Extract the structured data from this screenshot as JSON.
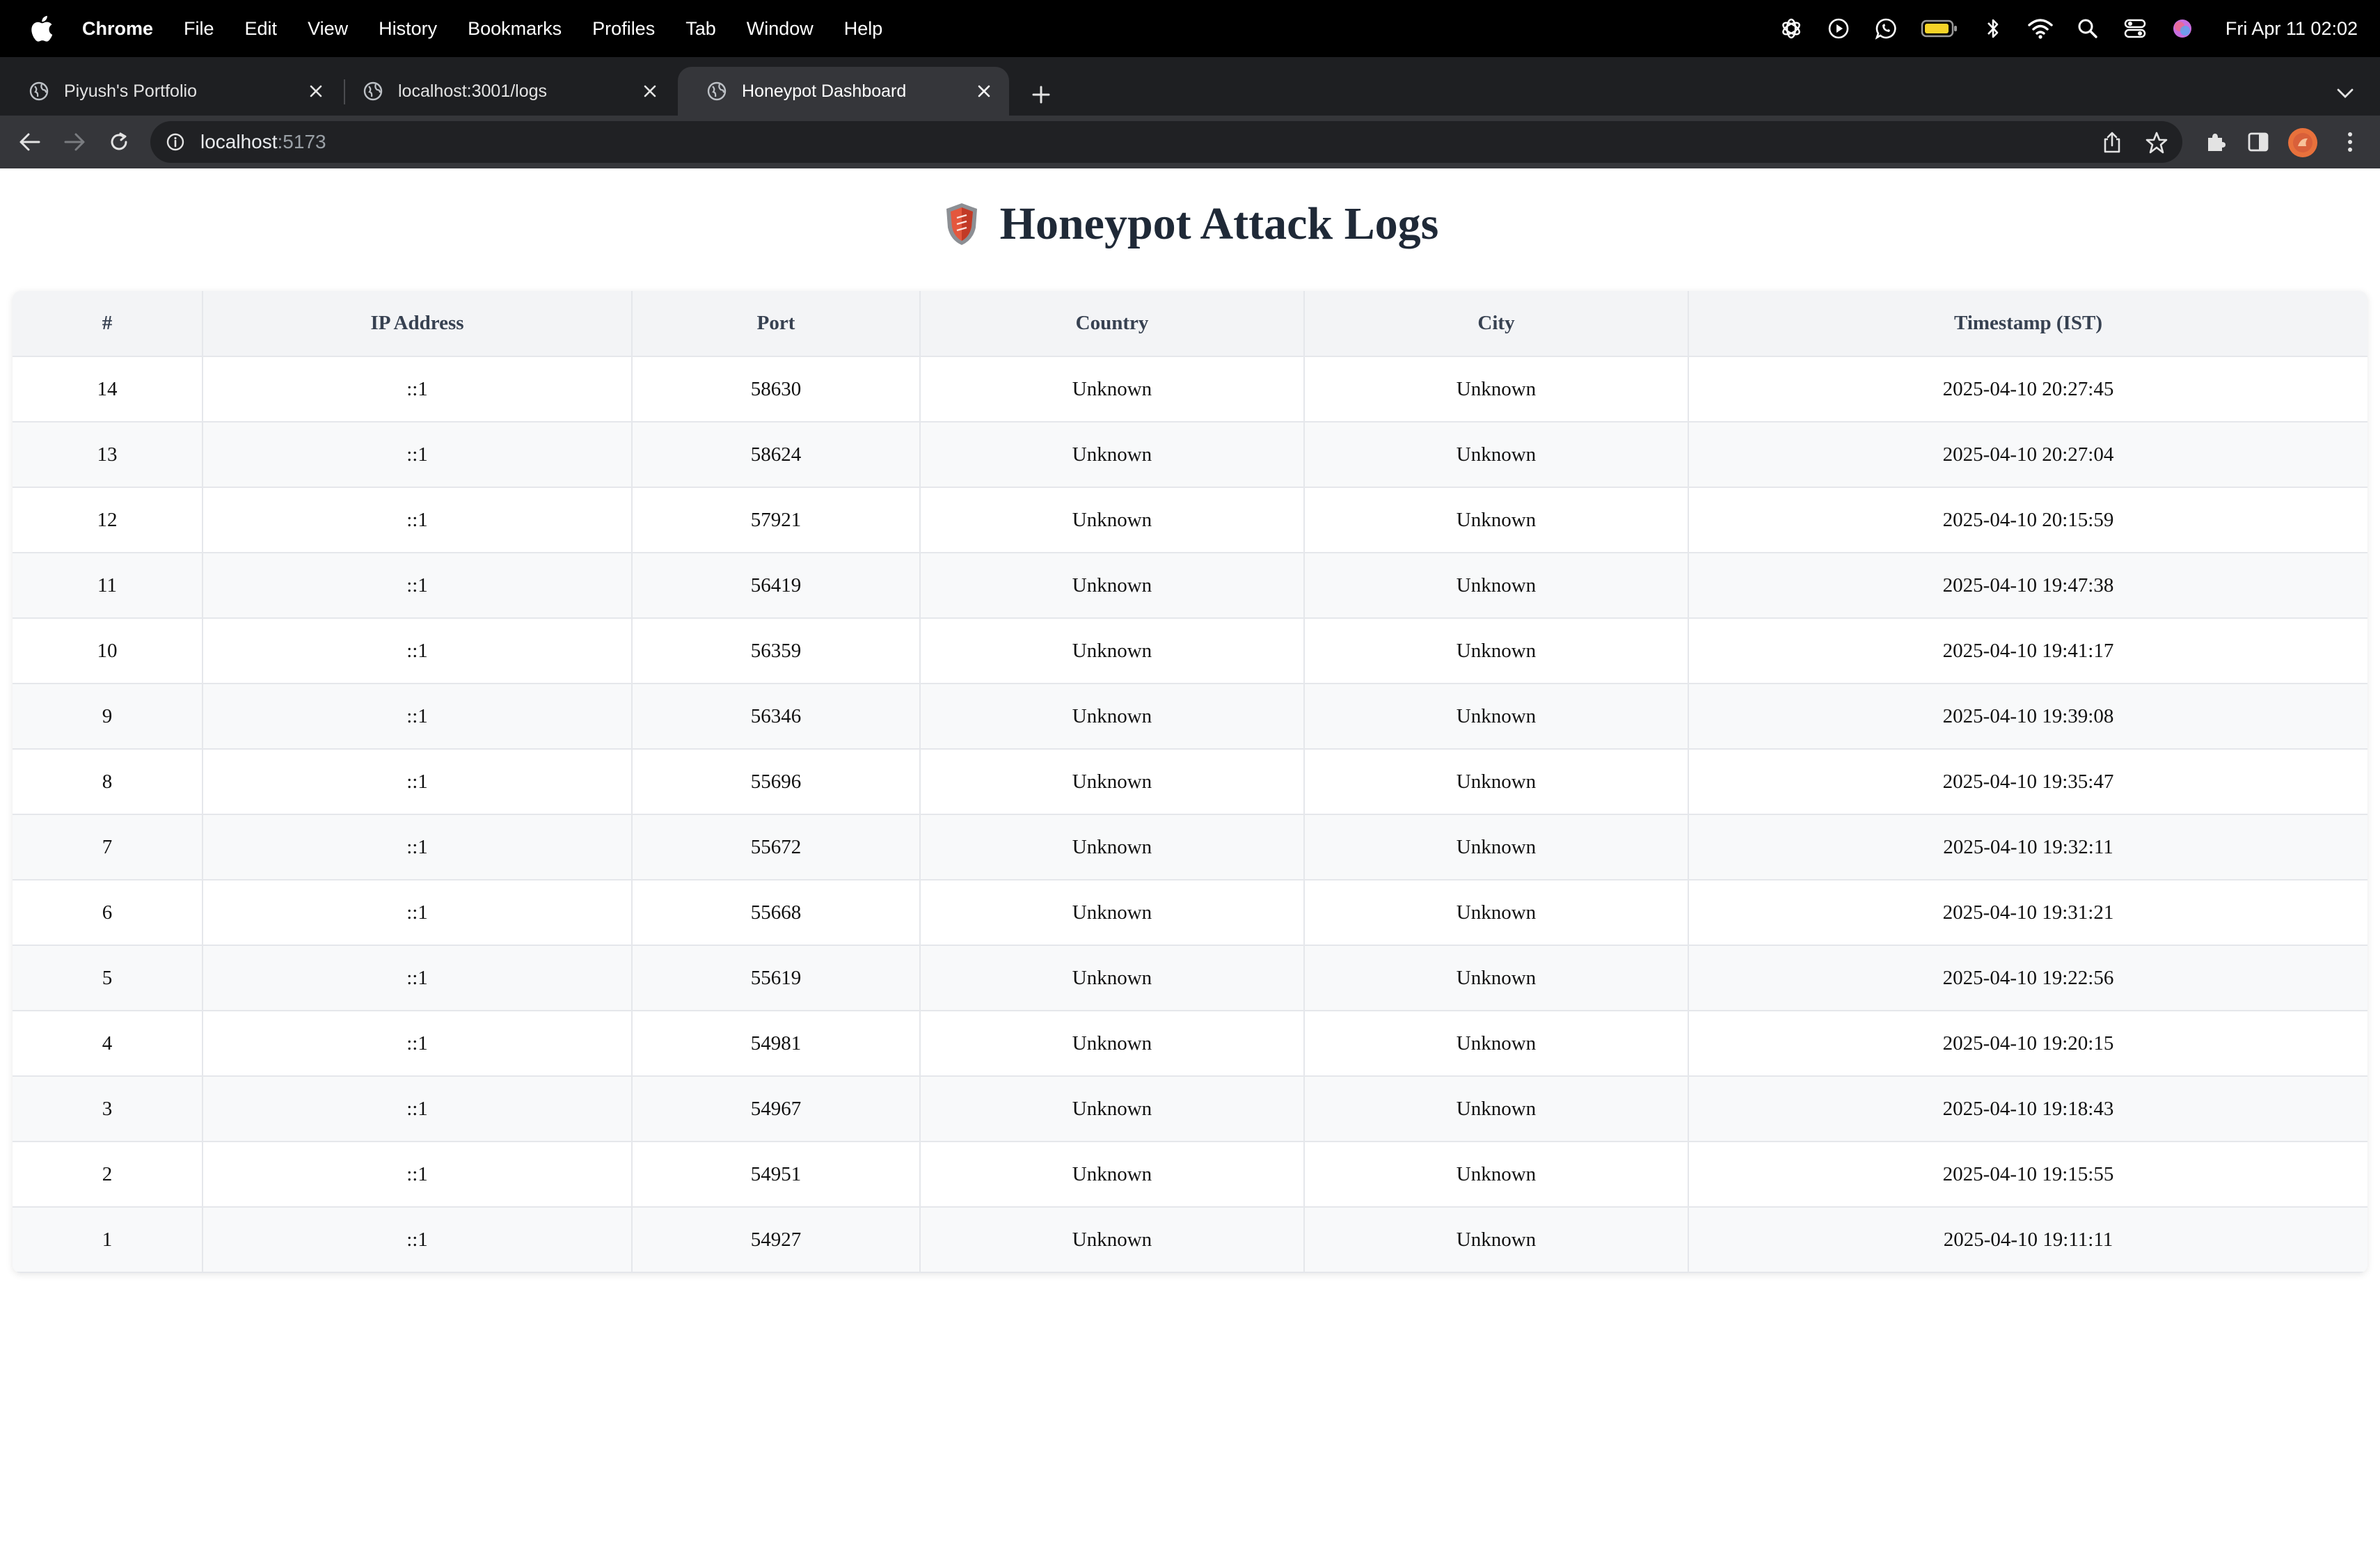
{
  "menubar": {
    "app_name": "Chrome",
    "items": [
      "File",
      "Edit",
      "View",
      "History",
      "Bookmarks",
      "Profiles",
      "Tab",
      "Window",
      "Help"
    ],
    "clock": "Fri Apr 11  02:02",
    "status_icons": [
      "chatgpt-icon",
      "play-icon",
      "whatsapp-icon",
      "battery-icon",
      "bluetooth-icon",
      "wifi-icon",
      "spotlight-search-icon",
      "control-center-icon",
      "siri-icon"
    ]
  },
  "tabs": [
    {
      "title": "Piyush's Portfolio",
      "active": false
    },
    {
      "title": "localhost:3001/logs",
      "active": false
    },
    {
      "title": "Honeypot Dashboard",
      "active": true
    }
  ],
  "toolbar": {
    "url_host": "localhost",
    "url_port": ":5173"
  },
  "page": {
    "title": "Honeypot Attack Logs",
    "columns": [
      "#",
      "IP Address",
      "Port",
      "Country",
      "City",
      "Timestamp (IST)"
    ],
    "rows": [
      [
        "14",
        "::1",
        "58630",
        "Unknown",
        "Unknown",
        "2025-04-10 20:27:45"
      ],
      [
        "13",
        "::1",
        "58624",
        "Unknown",
        "Unknown",
        "2025-04-10 20:27:04"
      ],
      [
        "12",
        "::1",
        "57921",
        "Unknown",
        "Unknown",
        "2025-04-10 20:15:59"
      ],
      [
        "11",
        "::1",
        "56419",
        "Unknown",
        "Unknown",
        "2025-04-10 19:47:38"
      ],
      [
        "10",
        "::1",
        "56359",
        "Unknown",
        "Unknown",
        "2025-04-10 19:41:17"
      ],
      [
        "9",
        "::1",
        "56346",
        "Unknown",
        "Unknown",
        "2025-04-10 19:39:08"
      ],
      [
        "8",
        "::1",
        "55696",
        "Unknown",
        "Unknown",
        "2025-04-10 19:35:47"
      ],
      [
        "7",
        "::1",
        "55672",
        "Unknown",
        "Unknown",
        "2025-04-10 19:32:11"
      ],
      [
        "6",
        "::1",
        "55668",
        "Unknown",
        "Unknown",
        "2025-04-10 19:31:21"
      ],
      [
        "5",
        "::1",
        "55619",
        "Unknown",
        "Unknown",
        "2025-04-10 19:22:56"
      ],
      [
        "4",
        "::1",
        "54981",
        "Unknown",
        "Unknown",
        "2025-04-10 19:20:15"
      ],
      [
        "3",
        "::1",
        "54967",
        "Unknown",
        "Unknown",
        "2025-04-10 19:18:43"
      ],
      [
        "2",
        "::1",
        "54951",
        "Unknown",
        "Unknown",
        "2025-04-10 19:15:55"
      ],
      [
        "1",
        "::1",
        "54927",
        "Unknown",
        "Unknown",
        "2025-04-10 19:11:11"
      ]
    ]
  },
  "colors": {
    "header_bg": "#f3f4f6",
    "stripe_bg": "#f8f9fa",
    "title_text": "#1f2937",
    "tabstrip_bg": "#1e1f22",
    "toolbar_bg": "#35363a"
  }
}
